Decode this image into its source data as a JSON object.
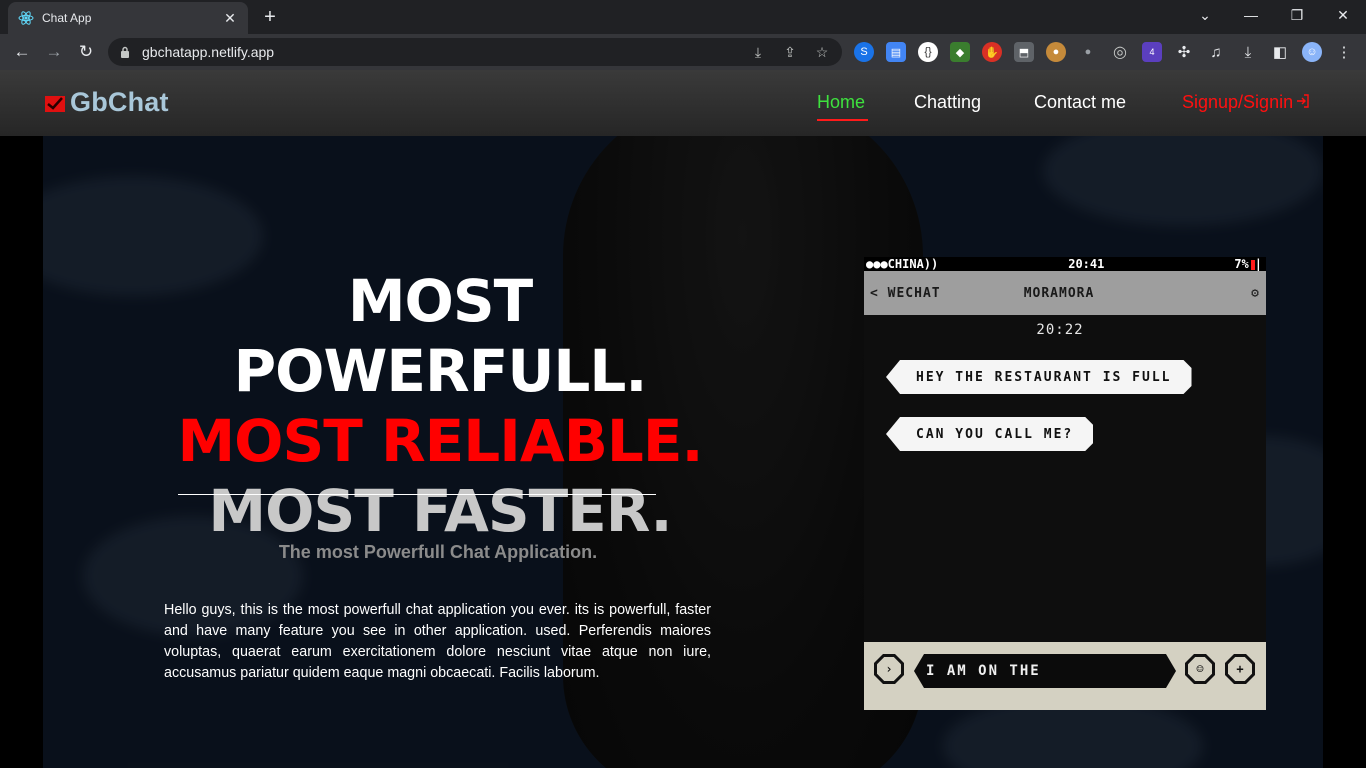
{
  "browser": {
    "tab_title": "Chat App",
    "tab_close": "✕",
    "new_tab": "+",
    "url": "gbchatapp.netlify.app",
    "controls": {
      "minimize": "—",
      "restore": "❐",
      "close": "✕",
      "dropdown": "⌄"
    },
    "extension_badge": "4"
  },
  "nav": {
    "brand": "GbChat",
    "links": [
      "Home",
      "Chatting",
      "Contact me"
    ],
    "signup": "Signup/Signin",
    "active_color": "#3ee23e",
    "accent_color": "#ff0000"
  },
  "hero": {
    "line1": "MOST POWERFULL.",
    "line2": "MOST RELIABLE.",
    "line3": "MOST FASTER.",
    "tagline": "The most Powerfull Chat Application.",
    "description": "Hello guys, this is the most powerfull chat application you ever. its is powerfull, faster and have many feature you see in other application. used. Perferendis maiores voluptas, quaerat earum exercitationem dolore nesciunt vitae atque non iure, accusamus pariatur quidem eaque magni obcaecati. Facilis laborum."
  },
  "phone": {
    "carrier": "●●●CHINA))",
    "clock": "20:41",
    "battery": "7%",
    "back_label": "< WECHAT",
    "contact": "MORAMORA",
    "chat_time": "20:22",
    "messages": [
      "HEY THE RESTAURANT IS FULL",
      "CAN YOU CALL ME?"
    ],
    "input_text": "I AM ON THE"
  }
}
